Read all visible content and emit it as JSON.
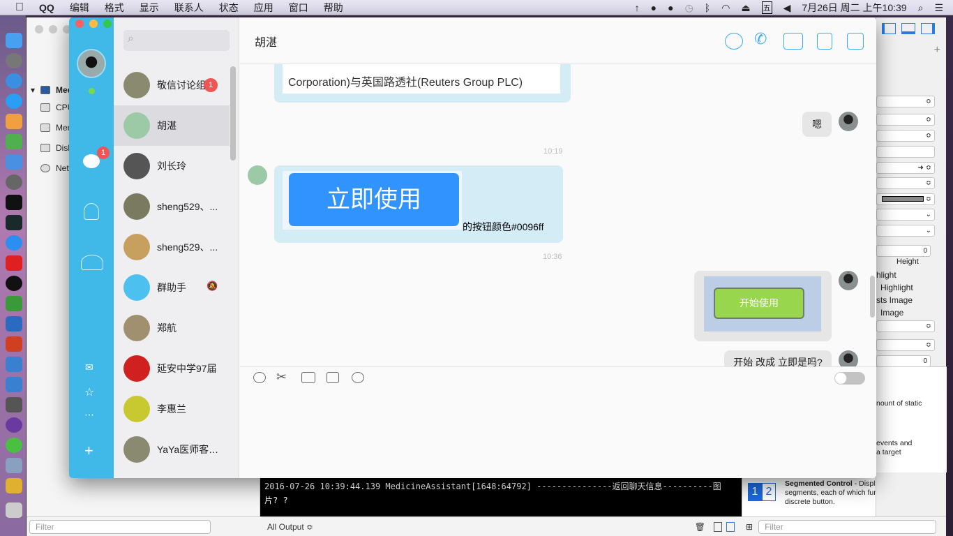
{
  "menubar": {
    "apple": "",
    "app": "QQ",
    "items": [
      "编辑",
      "格式",
      "显示",
      "联系人",
      "状态",
      "应用",
      "窗口",
      "帮助"
    ],
    "clock": "7月26日 周二 上午10:39",
    "input_method": "五"
  },
  "xcode": {
    "navigator": {
      "project": "Medi",
      "items": [
        "CPU",
        "Mem",
        "Disk",
        "Netw"
      ]
    },
    "console": {
      "line1": "2016-07-26 10:39:44.139 MedicineAssistant[1648:64792] ---------------返回聊天信息----------图",
      "line2": "片? ?"
    },
    "bottom": {
      "filter_left": "Filter",
      "output_select": "All Output ≎",
      "filter_right": "Filter"
    },
    "inspector": {
      "stepper_value_1": "0",
      "stepper_value_2": "0",
      "height_label": "Height",
      "checks": [
        "hlight",
        "Highlight",
        "sts Image",
        "Image"
      ]
    },
    "library": {
      "item1_desc": "nount of static",
      "item2_desc_a": "events and",
      "item2_desc_b": "a target",
      "seg_icon_1": "1",
      "seg_icon_2": "2",
      "seg_title": "Segmented Control",
      "seg_desc": " - Displays multiple segments, each of which functions as a discrete button."
    }
  },
  "qq": {
    "sidebar": {
      "unread_badge": "1"
    },
    "contacts": [
      {
        "name": "敬信讨论组",
        "badge": "1",
        "color": "#8a8a70"
      },
      {
        "name": "胡湛",
        "selected": true,
        "color": "#9cc9a6"
      },
      {
        "name": "刘长玲",
        "color": "#555"
      },
      {
        "name": "sheng529、...",
        "color": "#7a7a60"
      },
      {
        "name": "sheng529、...",
        "color": "#c7a060"
      },
      {
        "name": "群助手",
        "color": "#4cc0ef",
        "muted": true
      },
      {
        "name": "郑航",
        "color": "#a09070"
      },
      {
        "name": "延安中学97届",
        "color": "#d02020"
      },
      {
        "name": "李惠兰",
        "color": "#c8c830"
      },
      {
        "name": "YaYa医师客户...",
        "color": "#8a8a70"
      }
    ],
    "chat": {
      "title": "胡湛",
      "msg1_text": "Corporation)与英国路透社(Reuters Group PLC)",
      "msg2_text": "嗯",
      "time1": "10:19",
      "msg3_image_button": "立即使用",
      "msg3_text": "的按钮颜色#0096ff",
      "time2": "10:36",
      "msg4_image_button": "开始使用",
      "msg5_text": "开始 改成 立即是吗?",
      "colors": {
        "blue_button": "#3193fd",
        "green_button": "#97d64d",
        "bubble_in": "#d4ecf5",
        "bubble_out": "#e6e6e6"
      }
    }
  }
}
